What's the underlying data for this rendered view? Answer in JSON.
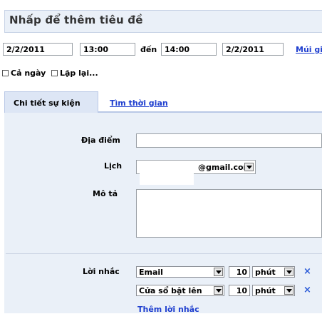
{
  "title": {
    "placeholder": "Nhấp để thêm tiêu đề"
  },
  "datetime": {
    "start_date": "2/2/2011",
    "start_time": "13:00",
    "to_label": "đến",
    "end_time": "14:00",
    "end_date": "2/2/2011",
    "timezone_link": "Múi gi"
  },
  "options": {
    "all_day": "Cả ngày",
    "repeat": "Lặp lại..."
  },
  "tabs": [
    {
      "label": "Chi tiết sự kiện"
    },
    {
      "label": "Tìm thời gian"
    }
  ],
  "details": {
    "location_label": "Địa điểm",
    "calendar_label": "Lịch",
    "calendar_value": "@gmail.com",
    "description_label": "Mô tả",
    "reminder_label": "Lời nhắc",
    "reminders": [
      {
        "type": "Email",
        "amount": "10",
        "unit": "phút"
      },
      {
        "type": "Cửa sổ bật lên",
        "amount": "10",
        "unit": "phút"
      }
    ],
    "add_reminder": "Thêm lời nhắc"
  }
}
